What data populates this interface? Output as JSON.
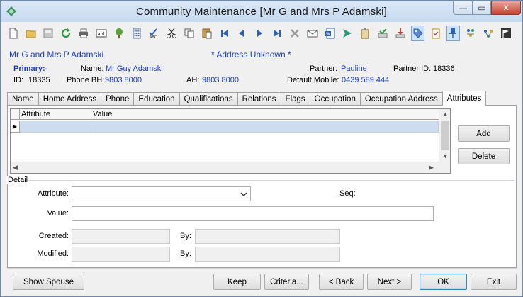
{
  "window": {
    "title": "Community Maintenance  [Mr G and Mrs P Adamski]",
    "controls": {
      "minimize": "—",
      "maximize": "▭",
      "close": "✕"
    }
  },
  "toolbar": {
    "icons": [
      "new-document-icon",
      "open-folder-icon",
      "save-icon",
      "refresh-icon",
      "print-icon",
      "text-field-icon",
      "tree-icon",
      "calculator-icon",
      "spellcheck-icon",
      "cut-icon",
      "copy-icon",
      "paste-icon",
      "first-record-icon",
      "previous-record-icon",
      "next-record-icon",
      "last-record-icon",
      "delete-icon",
      "email-icon",
      "word-document-icon",
      "forward-icon",
      "clipboard-icon",
      "approve-icon",
      "download-icon",
      "tag-icon",
      "checklist-icon",
      "pin-icon",
      "family-icon",
      "relations-icon",
      "flag-icon"
    ]
  },
  "header": {
    "display_name": "Mr G and Mrs P Adamski",
    "address_status": "* Address Unknown *",
    "primary_label": "Primary:-",
    "name_label": "Name:",
    "name_value": "Mr Guy Adamski",
    "partner_label": "Partner:",
    "partner_value": "Pauline",
    "partner_id_label": "Partner ID:",
    "partner_id_value": "18336",
    "id_label": "ID:",
    "id_value": "18335",
    "phone_bh_label": "Phone BH:",
    "phone_bh_value": "9803 8000",
    "ah_label": "AH:",
    "ah_value": "9803 8000",
    "mobile_label": "Default Mobile:",
    "mobile_value": "0439 589 444"
  },
  "tabs": [
    {
      "label": "Name"
    },
    {
      "label": "Home Address"
    },
    {
      "label": "Phone"
    },
    {
      "label": "Education"
    },
    {
      "label": "Qualifications"
    },
    {
      "label": "Relations"
    },
    {
      "label": "Flags"
    },
    {
      "label": "Occupation"
    },
    {
      "label": "Occupation Address"
    },
    {
      "label": "Attributes",
      "selected": true
    }
  ],
  "grid": {
    "columns": [
      "Attribute",
      "Value"
    ],
    "row_indicator": "▶"
  },
  "side_buttons": {
    "add": "Add",
    "delete": "Delete"
  },
  "detail": {
    "group_label": "Detail",
    "attribute_label": "Attribute:",
    "attribute_value": "",
    "seq_label": "Seq:",
    "value_label": "Value:",
    "value_value": "",
    "created_label": "Created:",
    "created_by_label": "By:",
    "modified_label": "Modified:",
    "modified_by_label": "By:"
  },
  "footer": {
    "show_spouse": "Show Spouse",
    "keep": "Keep",
    "criteria": "Criteria...",
    "back": "< Back",
    "next": "Next >",
    "ok": "OK",
    "exit": "Exit"
  },
  "colors": {
    "accent_text": "#1a3cc8",
    "selection": "#cddcef",
    "window_bg": "#f0f0f0",
    "title_bar": "#c6d9ef"
  }
}
